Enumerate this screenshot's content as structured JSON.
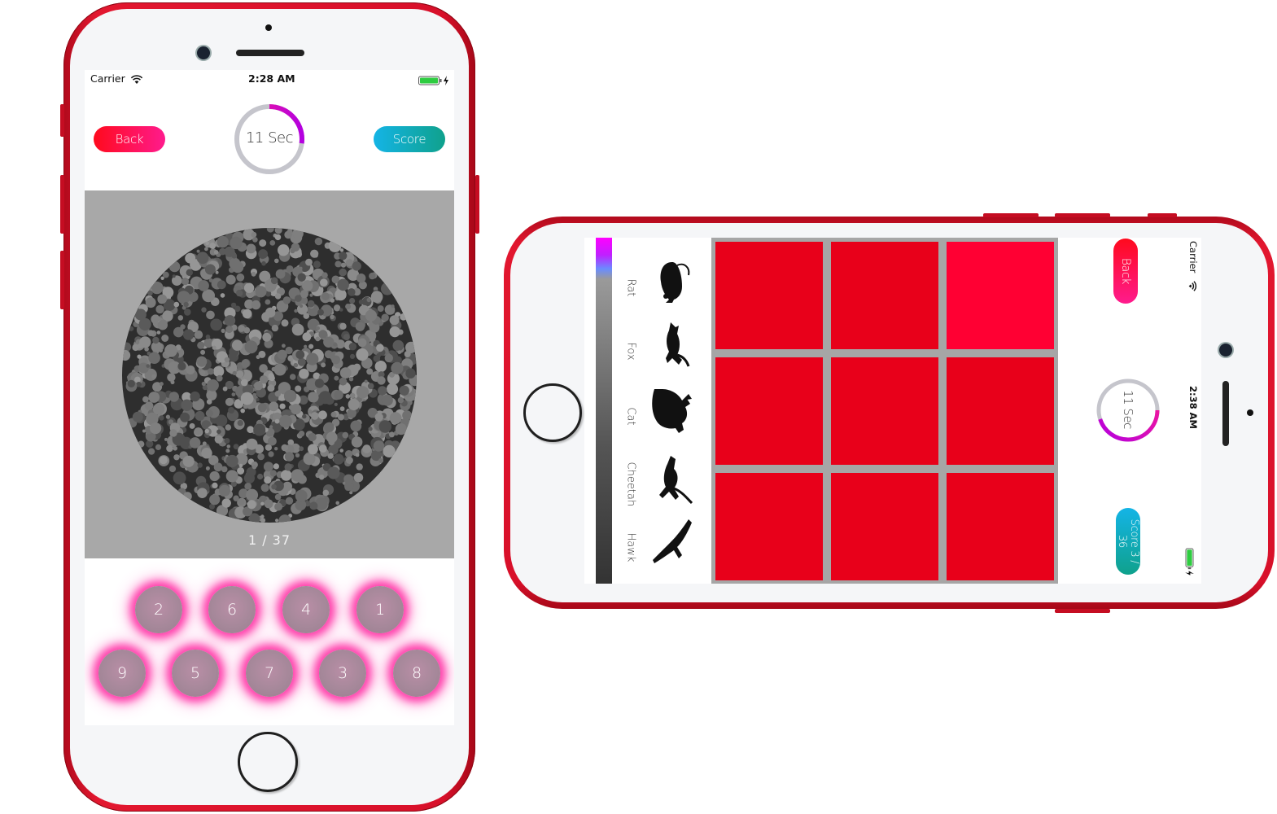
{
  "portrait": {
    "status_bar": {
      "carrier": "Carrier",
      "time": "2:28 AM"
    },
    "back_label": "Back",
    "score_label": "Score",
    "timer": {
      "label": "11 Sec",
      "progress": 0.27
    },
    "plate_counter": "1 / 37",
    "number_row_1": [
      "2",
      "6",
      "4",
      "1"
    ],
    "number_row_2": [
      "9",
      "5",
      "7",
      "3",
      "8"
    ]
  },
  "landscape": {
    "status_bar": {
      "carrier": "Carrier",
      "time": "2:38 AM"
    },
    "back_label": "Back",
    "score_label": "Score 3 / 36",
    "timer": {
      "label": "11 Sec",
      "progress": 0.45
    },
    "animals": [
      "Rat",
      "Fox",
      "Cat",
      "Cheetah",
      "Hawk"
    ],
    "tile_colors": [
      "#e8001a",
      "#e8001a",
      "#ff0033",
      "#e8001a",
      "#e8001a",
      "#e8001a",
      "#e8001a",
      "#e8001a",
      "#e8001a"
    ]
  },
  "colors": {
    "phone_red": "#d8102a",
    "back_gradient": [
      "#ff0a1d",
      "#ff1b8d"
    ],
    "score_gradient": [
      "#14b4e6",
      "#0fa18c"
    ],
    "timer_arc": [
      "#ff1b8d",
      "#b400e0"
    ],
    "glow": "#ff28a0"
  },
  "icons": [
    "wifi-icon",
    "battery-charging-icon",
    "rat-icon",
    "fox-icon",
    "cat-icon",
    "cheetah-icon",
    "hawk-icon"
  ]
}
